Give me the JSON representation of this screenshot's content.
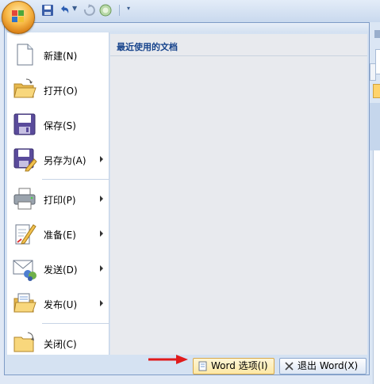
{
  "menu": {
    "recent_title": "最近使用的文档",
    "items": [
      {
        "label": "新建(N)",
        "icon": "new-document-icon",
        "has_submenu": false
      },
      {
        "label": "打开(O)",
        "icon": "open-folder-icon",
        "has_submenu": false
      },
      {
        "label": "保存(S)",
        "icon": "save-disk-icon",
        "has_submenu": false
      },
      {
        "label": "另存为(A)",
        "icon": "save-as-icon",
        "has_submenu": true
      },
      {
        "label": "打印(P)",
        "icon": "printer-icon",
        "has_submenu": true
      },
      {
        "label": "准备(E)",
        "icon": "prepare-icon",
        "has_submenu": true
      },
      {
        "label": "发送(D)",
        "icon": "send-icon",
        "has_submenu": true
      },
      {
        "label": "发布(U)",
        "icon": "publish-icon",
        "has_submenu": true
      },
      {
        "label": "关闭(C)",
        "icon": "close-folder-icon",
        "has_submenu": false
      }
    ],
    "options_label": "Word 选项(I)",
    "exit_label": "退出 Word(X)"
  },
  "colors": {
    "accent_arrow": "#e01b1b",
    "panel": "#d5e2f2",
    "orb": "#f7b847"
  }
}
